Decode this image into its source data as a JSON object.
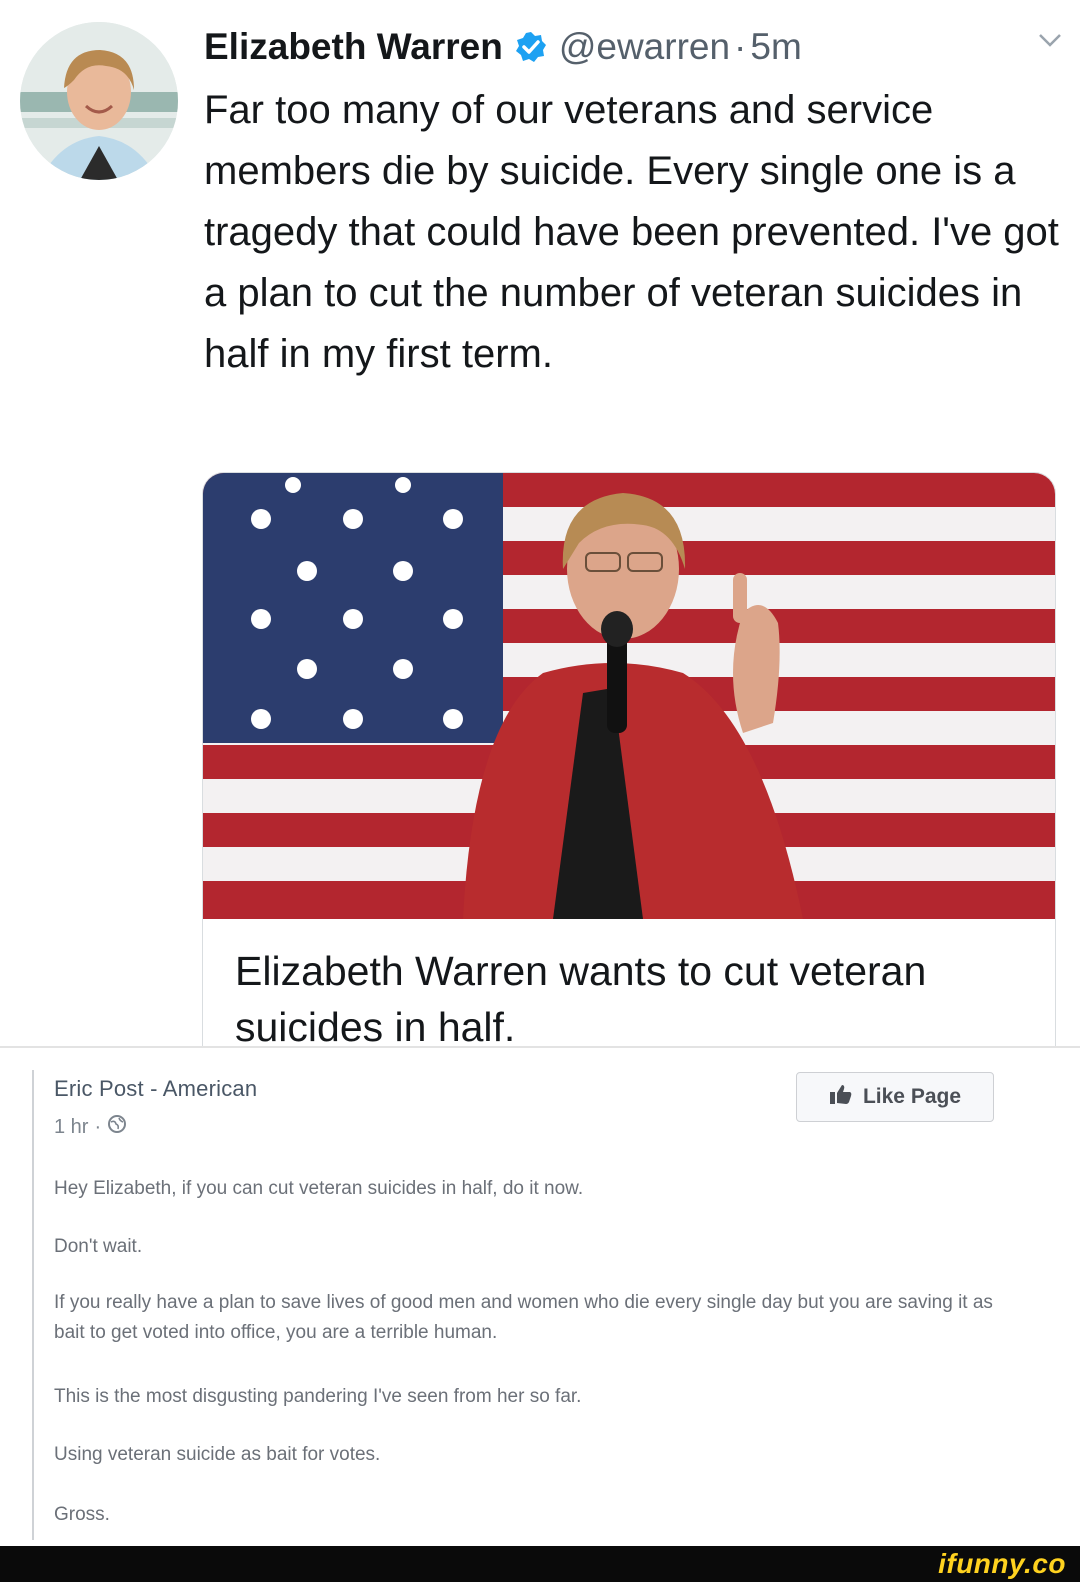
{
  "tweet": {
    "author_name": "Elizabeth Warren",
    "verified_icon": "verified-badge-icon",
    "handle": "@ewarren",
    "separator": "·",
    "time": "5m",
    "menu_icon": "chevron-down-icon",
    "text": "Far too many of our veterans and service members die by suicide. Every single one is a tragedy that could have been prevented. I've got a plan to cut the number of veteran suicides in half in my first term.",
    "card": {
      "image": "photo-speaker-with-flag",
      "title": "Elizabeth Warren wants to cut veteran suicides in half."
    },
    "colors": {
      "verified": "#1da1f2",
      "text": "#14171a",
      "muted": "#55606b"
    }
  },
  "facebook_post": {
    "author": "Eric Post - American",
    "time": "1 hr",
    "meta_separator": "·",
    "privacy_icon": "globe-icon",
    "like_button_label": "Like Page",
    "like_icon": "thumbs-up-icon",
    "paragraphs": [
      "Hey Elizabeth, if you can cut veteran suicides in half, do it now.",
      "Don't wait.",
      "If you really have a plan to save lives of good men and women who die every single day but you are saving it as bait to get voted into office, you are a terrible human.",
      "This is the most disgusting pandering I've seen from her so far.",
      "Using veteran suicide as bait for votes.",
      "Gross."
    ]
  },
  "watermark": {
    "text": "ifunny.co",
    "color": "#ffd21f"
  }
}
